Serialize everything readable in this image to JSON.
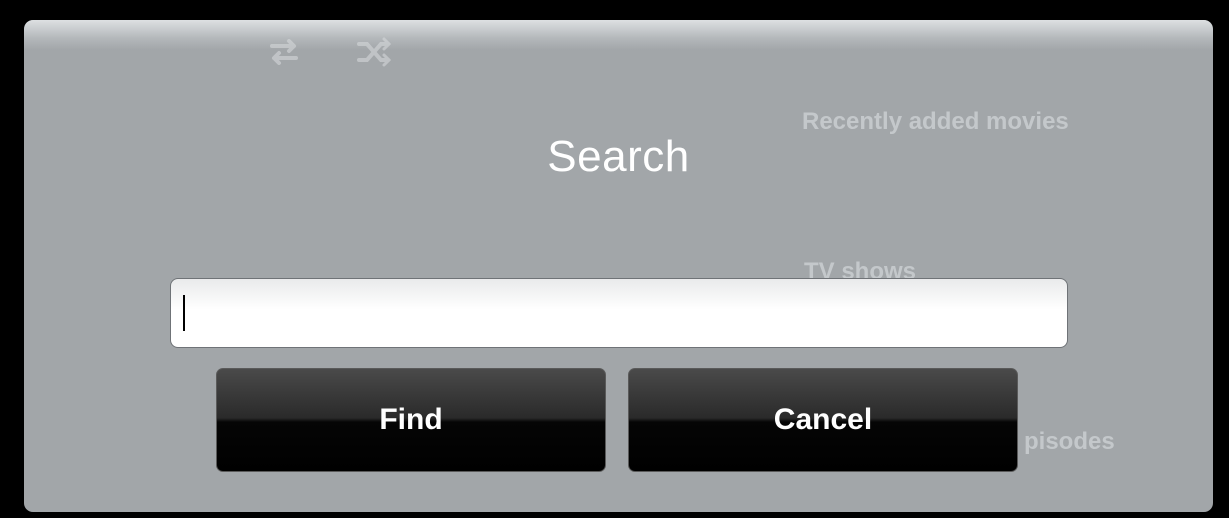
{
  "background": {
    "section_recent_movies": "Recently added movies",
    "section_tv_shows": "TV shows",
    "section_episodes": "pisodes",
    "icons": [
      "repeat-icon",
      "shuffle-icon"
    ]
  },
  "dialog": {
    "title": "Search",
    "search_value": "",
    "find_label": "Find",
    "cancel_label": "Cancel"
  },
  "colors": {
    "panel": "#a2a6a9",
    "button": "#1a1a1a",
    "title": "#ffffff"
  }
}
